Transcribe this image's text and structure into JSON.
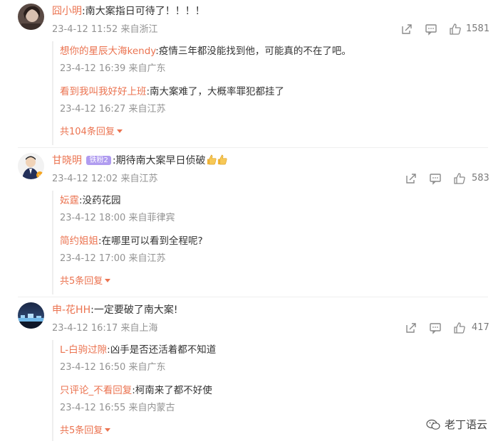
{
  "comments": [
    {
      "username": "囧小明",
      "text": ":南大案指日可待了！！！！",
      "date": "23-4-12 11:52",
      "location": "来自浙江",
      "likes": "1581",
      "replies": [
        {
          "username": "想你的星辰大海kendy",
          "text": ":疫情三年都没能找到他，可能真的不在了吧。",
          "date": "23-4-12 16:39",
          "location": "来自广东"
        },
        {
          "username": "看到我叫我好好上班",
          "text": ":南大案难了，大概率罪犯都挂了",
          "date": "23-4-12 16:27",
          "location": "来自江苏"
        }
      ],
      "more_label": "共104条回复"
    },
    {
      "username": "甘晓明",
      "badge": "铁粉2",
      "text": ":期待南大案早日侦破",
      "date": "23-4-12 12:02",
      "location": "来自江苏",
      "likes": "583",
      "replies": [
        {
          "username": "妘霆",
          "text": ":没药花园",
          "date": "23-4-12 18:00",
          "location": "来自菲律宾"
        },
        {
          "username": "简约姐姐",
          "text": ":在哪里可以看到全程呢?",
          "date": "23-4-12 17:00",
          "location": "来自江苏"
        }
      ],
      "more_label": "共5条回复"
    },
    {
      "username": "申-花HH",
      "text": ":一定要破了南大案!",
      "date": "23-4-12 16:17",
      "location": "来自上海",
      "likes": "417",
      "replies": [
        {
          "username": "L-白驹过隙",
          "text": ":凶手是否还活着都不知道",
          "date": "23-4-12 16:50",
          "location": "来自广东"
        },
        {
          "username": "只评论_不看回复",
          "text": ":柯南来了都不好使",
          "date": "23-4-12 16:55",
          "location": "来自内蒙古"
        }
      ],
      "more_label": "共5条回复"
    }
  ],
  "watermark": "老丁语云",
  "colors": {
    "username": "#eb7350",
    "meta": "#939393",
    "badge": "#b09cf0"
  },
  "icons": [
    "share-icon",
    "comment-icon",
    "like-icon",
    "chevron-down-icon",
    "thumbs-up-emoji-icon",
    "wechat-icon"
  ]
}
